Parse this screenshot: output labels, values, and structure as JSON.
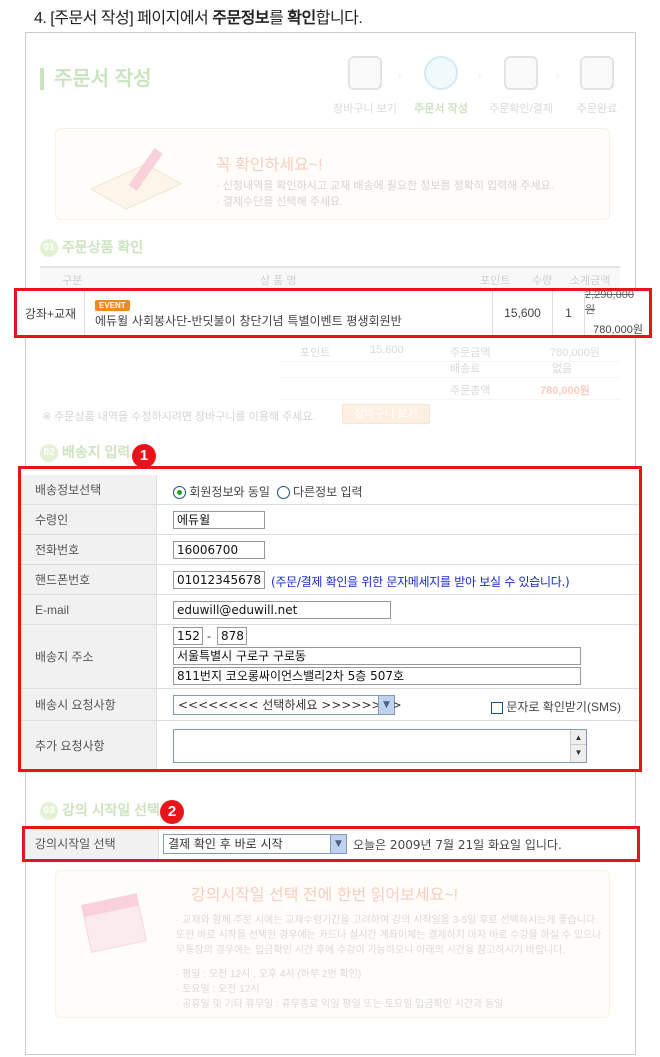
{
  "caption": {
    "prefix": "4. [주문서 작성] 페이지에서 ",
    "bold1": "주문정보",
    "mid": "를 ",
    "bold2": "확인",
    "suffix": "합니다."
  },
  "page_title": "주문서 작성",
  "steps": [
    "장바구니 보기",
    "주문서 작성",
    "주문확인/결제",
    "주문완료"
  ],
  "notice": {
    "title": "꼭 확인하세요~!",
    "line1": "· 신청내역을 확인하시고 교재 배송에 필요한 정보를 정확히 입력해 주세요.",
    "line2": "· 결제수단을 선택해 주세요."
  },
  "sections": {
    "order": "주문상품 확인",
    "shipping": "배송지 입력",
    "start": "강의 시작일 선택"
  },
  "section_nums": [
    "01",
    "02",
    "03"
  ],
  "table_headers": {
    "type": "구분",
    "name": "상 품 명",
    "point": "포인트",
    "qty": "수량",
    "amount": "소계금액"
  },
  "product": {
    "type": "강좌+교재",
    "event": "EVENT",
    "name": "에듀윌 사회봉사단-반딧불이 창단기념 특별이벤트 평생회원반",
    "point": "15,600",
    "qty": "1",
    "orig_price": "2,290,000원",
    "price": "780,000원"
  },
  "summary": {
    "point_label": "포인트",
    "point_value": "15,600",
    "amount_label": "주문금액",
    "amount_value": "780,000원",
    "ship_label": "배송료",
    "ship_value": "없음",
    "total_label": "주문총액",
    "total_value": "780,000원"
  },
  "cart_note": "※ 주문상품 내역을 수정하시려면 장바구니를 이용해 주세요.",
  "cart_button": "장바구니 보기",
  "badges": [
    "1",
    "2"
  ],
  "form": {
    "ship_info_label": "배송정보선택",
    "radio_same": "회원정보와 동일",
    "radio_other": "다른정보 입력",
    "receiver_label": "수령인",
    "receiver_value": "에듀윌",
    "phone_label": "전화번호",
    "phone_value": "16006700",
    "mobile_label": "핸드폰번호",
    "mobile_value": "01012345678",
    "mobile_note": "(주문/결제 확인을 위한 문자메세지를 받아 보실 수 있습니다.)",
    "email_label": "E-mail",
    "email_value": "eduwill@eduwill.net",
    "address_label": "배송지 주소",
    "zip1": "152",
    "zip_sep": "-",
    "zip2": "878",
    "addr1": "서울특별시 구로구 구로동",
    "addr2": "811번지 코오롱싸이언스밸리2차 5층 507호",
    "request_label": "배송시 요청사항",
    "request_select": "<<<<<<<< 선택하세요 >>>>>>>>",
    "sms_label": "문자로 확인받기(SMS)",
    "extra_label": "추가 요청사항"
  },
  "start": {
    "label": "강의시작일 선택",
    "select": "결제 확인 후 바로 시작",
    "today_note": "오늘은 2009년 7월 21일 화요일 입니다."
  },
  "guide": {
    "title": "강의시작일 선택 전에 한번 읽어보세요~!",
    "line1": "· 교재와 함께 주문 시에는 교재수령기간을 고려하여 강의 시작일을 3-5일 후로 선택하시는게 좋습니다.",
    "line2": "또한 바로 시작을 선택한 경우에는 카드나 실시간 계좌이체는 결제하지 마자 바로 수강을 하실 수 있으나",
    "line3": "무통장의 경우에는 입금확인 시간 후에 수강이 가능하오니 아래의 시간을 참고하시기 바랍니다.",
    "line4": "· 평일 : 오전 12시 , 오후 4시 (하루 2번 확인)",
    "line5": "· 토요일 : 오전 12시",
    "line6": "· 공휴일 및 기타 휴무일 : 휴무종료 익일 평일 또는 토요일 입금확인 시간과 동일"
  }
}
